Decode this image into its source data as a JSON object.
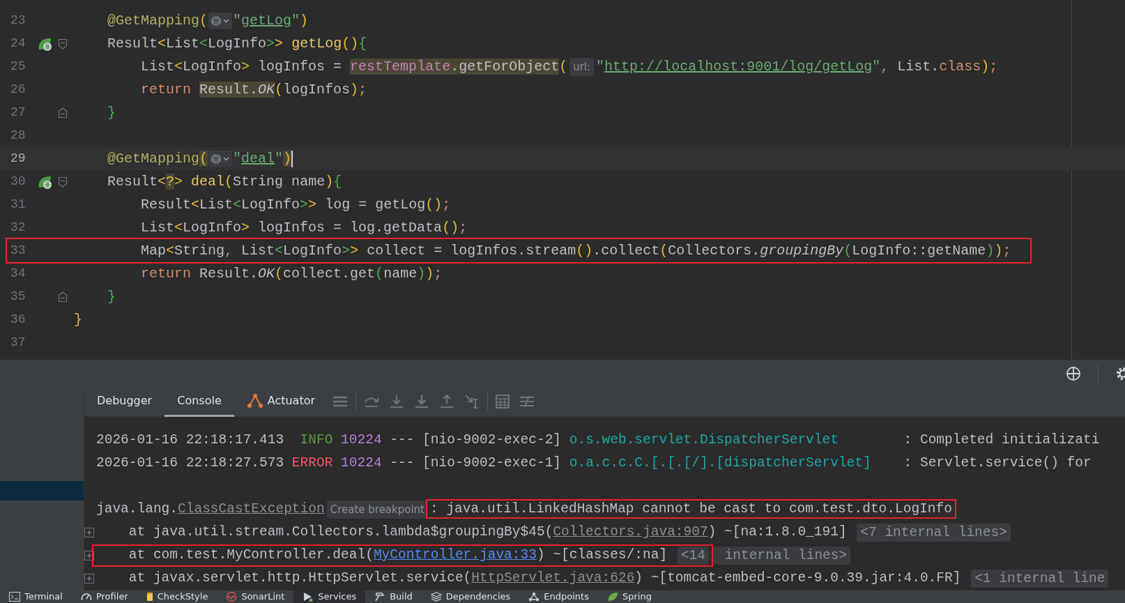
{
  "editor": {
    "lines": [
      {
        "number": "23",
        "tokens": [
          {
            "kind": "ann",
            "text": "    @GetMapping"
          },
          {
            "kind": "b1",
            "text": "("
          },
          {
            "kind": "inlay-globe"
          },
          {
            "kind": "str",
            "text": "\""
          },
          {
            "kind": "strlink",
            "text": "getLog"
          },
          {
            "kind": "str",
            "text": "\""
          },
          {
            "kind": "b1",
            "text": ")"
          }
        ]
      },
      {
        "number": "24",
        "endpoint_icon": true,
        "fold_start": true,
        "tokens": [
          {
            "kind": "plain",
            "text": "    Result"
          },
          {
            "kind": "b1",
            "text": "<"
          },
          {
            "kind": "plain",
            "text": "List"
          },
          {
            "kind": "b2",
            "text": "<"
          },
          {
            "kind": "plain",
            "text": "LogInfo"
          },
          {
            "kind": "b2",
            "text": ">"
          },
          {
            "kind": "b1",
            "text": ">"
          },
          {
            "kind": "decl",
            "text": " getLog"
          },
          {
            "kind": "b1",
            "text": "()"
          },
          {
            "kind": "b2",
            "text": "{"
          }
        ]
      },
      {
        "number": "25",
        "tokens": [
          {
            "kind": "plain",
            "text": "        List"
          },
          {
            "kind": "b1",
            "text": "<"
          },
          {
            "kind": "plain",
            "text": "LogInfo"
          },
          {
            "kind": "b1",
            "text": ">"
          },
          {
            "kind": "plain",
            "text": " logInfos = "
          },
          {
            "kind": "field",
            "text": "restTemplate",
            "marked": true
          },
          {
            "kind": "plain",
            "text": ".getForObject",
            "marked": true
          },
          {
            "kind": "b1",
            "text": "("
          },
          {
            "kind": "hint",
            "text": "url:"
          },
          {
            "kind": "str",
            "text": "\""
          },
          {
            "kind": "strlink",
            "text": "http://localhost:9001/log/getLog"
          },
          {
            "kind": "str",
            "text": "\""
          },
          {
            "kind": "kw",
            "text": ", "
          },
          {
            "kind": "plain",
            "text": "List."
          },
          {
            "kind": "kw",
            "text": "class"
          },
          {
            "kind": "b1",
            "text": ")"
          },
          {
            "kind": "kw",
            "text": ";"
          }
        ]
      },
      {
        "number": "26",
        "tokens": [
          {
            "kind": "kw",
            "text": "        return "
          },
          {
            "kind": "plain",
            "text": "Result.",
            "marked": true
          },
          {
            "kind": "italic",
            "text": "OK",
            "marked": true
          },
          {
            "kind": "b1",
            "text": "("
          },
          {
            "kind": "plain",
            "text": "logInfos"
          },
          {
            "kind": "b1",
            "text": ")"
          },
          {
            "kind": "kw",
            "text": ";"
          }
        ]
      },
      {
        "number": "27",
        "fold_end": true,
        "tokens": [
          {
            "kind": "b2",
            "text": "    }"
          }
        ]
      },
      {
        "number": "28"
      },
      {
        "number": "29",
        "current": true,
        "tokens": [
          {
            "kind": "ann",
            "text": "    @GetMapping"
          },
          {
            "kind": "b1",
            "text": "(",
            "marked": true
          },
          {
            "kind": "inlay-globe"
          },
          {
            "kind": "str",
            "text": "\""
          },
          {
            "kind": "strlink",
            "text": "deal"
          },
          {
            "kind": "str",
            "text": "\""
          },
          {
            "kind": "b1",
            "text": ")",
            "marked": true
          }
        ]
      },
      {
        "number": "30",
        "endpoint_icon": true,
        "fold_start": true,
        "tokens": [
          {
            "kind": "plain",
            "text": "    Result"
          },
          {
            "kind": "b1",
            "text": "<"
          },
          {
            "kind": "b1",
            "text": "?",
            "marked": true
          },
          {
            "kind": "b1",
            "text": ">"
          },
          {
            "kind": "decl",
            "text": " deal"
          },
          {
            "kind": "b1",
            "text": "("
          },
          {
            "kind": "plain",
            "text": "String name"
          },
          {
            "kind": "b1",
            "text": ")"
          },
          {
            "kind": "b2",
            "text": "{"
          }
        ]
      },
      {
        "number": "31",
        "tokens": [
          {
            "kind": "plain",
            "text": "        Result"
          },
          {
            "kind": "b1",
            "text": "<"
          },
          {
            "kind": "plain",
            "text": "List"
          },
          {
            "kind": "b2",
            "text": "<"
          },
          {
            "kind": "plain",
            "text": "LogInfo"
          },
          {
            "kind": "b2",
            "text": ">"
          },
          {
            "kind": "b1",
            "text": ">"
          },
          {
            "kind": "plain",
            "text": " log = getLog"
          },
          {
            "kind": "b1",
            "text": "()"
          },
          {
            "kind": "kw",
            "text": ";"
          }
        ]
      },
      {
        "number": "32",
        "tokens": [
          {
            "kind": "plain",
            "text": "        List"
          },
          {
            "kind": "b1",
            "text": "<"
          },
          {
            "kind": "plain",
            "text": "LogInfo"
          },
          {
            "kind": "b1",
            "text": ">"
          },
          {
            "kind": "plain",
            "text": " logInfos = log.getData"
          },
          {
            "kind": "b1",
            "text": "()"
          },
          {
            "kind": "kw",
            "text": ";"
          }
        ]
      },
      {
        "number": "33",
        "highlighted": true,
        "tokens": [
          {
            "kind": "plain",
            "text": "        Map"
          },
          {
            "kind": "b1",
            "text": "<"
          },
          {
            "kind": "plain",
            "text": "String"
          },
          {
            "kind": "kw",
            "text": ", "
          },
          {
            "kind": "plain",
            "text": "List"
          },
          {
            "kind": "b2",
            "text": "<"
          },
          {
            "kind": "plain",
            "text": "LogInfo"
          },
          {
            "kind": "b2",
            "text": ">"
          },
          {
            "kind": "b1",
            "text": ">"
          },
          {
            "kind": "plain",
            "text": " collect = logInfos.stream"
          },
          {
            "kind": "b1",
            "text": "()"
          },
          {
            "kind": "plain",
            "text": ".collect"
          },
          {
            "kind": "b1",
            "text": "("
          },
          {
            "kind": "plain",
            "text": "Collectors."
          },
          {
            "kind": "italic",
            "text": "groupingBy"
          },
          {
            "kind": "b2",
            "text": "("
          },
          {
            "kind": "plain",
            "text": "LogInfo::getName"
          },
          {
            "kind": "b2",
            "text": ")"
          },
          {
            "kind": "b1",
            "text": ")"
          },
          {
            "kind": "kw",
            "text": ";"
          }
        ]
      },
      {
        "number": "34",
        "tokens": [
          {
            "kind": "kw",
            "text": "        return "
          },
          {
            "kind": "plain",
            "text": "Result."
          },
          {
            "kind": "italic",
            "text": "OK"
          },
          {
            "kind": "b1",
            "text": "("
          },
          {
            "kind": "plain",
            "text": "collect.get"
          },
          {
            "kind": "b2",
            "text": "("
          },
          {
            "kind": "plain",
            "text": "name"
          },
          {
            "kind": "b2",
            "text": ")"
          },
          {
            "kind": "b1",
            "text": ")"
          },
          {
            "kind": "kw",
            "text": ";"
          }
        ]
      },
      {
        "number": "35",
        "fold_end": true,
        "tokens": [
          {
            "kind": "b2",
            "text": "    }"
          }
        ]
      },
      {
        "number": "36",
        "tokens": [
          {
            "kind": "b1",
            "text": "}"
          }
        ]
      },
      {
        "number": "37"
      }
    ]
  },
  "tool_window": {
    "tabs": [
      {
        "label": "Debugger",
        "selected": false
      },
      {
        "label": "Console",
        "selected": true
      },
      {
        "label": "Actuator",
        "selected": false
      }
    ]
  },
  "console": {
    "lines": [
      {
        "kind": "log",
        "tokens": [
          {
            "kind": "plain",
            "text": "2026-01-16 22:18:17.413"
          },
          {
            "kind": "info",
            "text": "  INFO "
          },
          {
            "kind": "pid",
            "text": "10224"
          },
          {
            "kind": "plain",
            "text": " --- [nio-9002-exec-2] "
          },
          {
            "kind": "logger",
            "text": "o.s.web.servlet.DispatcherServlet"
          },
          {
            "kind": "plain",
            "text": "        : Completed initializati"
          }
        ]
      },
      {
        "kind": "log",
        "tokens": [
          {
            "kind": "plain",
            "text": "2026-01-16 22:18:27.573 "
          },
          {
            "kind": "error",
            "text": "ERROR"
          },
          {
            "kind": "pid",
            "text": " 10224"
          },
          {
            "kind": "plain",
            "text": " --- [nio-9002-exec-1] "
          },
          {
            "kind": "logger",
            "text": "o.a.c.c.C.[.[.[/].[dispatcherServlet]"
          },
          {
            "kind": "plain",
            "text": "    : Servlet.service() for"
          }
        ]
      },
      {
        "kind": "blank"
      },
      {
        "kind": "exception",
        "tokens": [
          {
            "kind": "plain",
            "text": "java.lang."
          },
          {
            "kind": "link-gray",
            "text": "ClassCastException"
          },
          {
            "kind": "hint-action",
            "text": "Create breakpoint"
          },
          {
            "kind": "plain",
            "text": ": java.util.LinkedHashMap cannot be cast to com.test.dto.LogInfo",
            "boxed": true
          }
        ]
      },
      {
        "kind": "trace",
        "tokens": [
          {
            "kind": "plain",
            "text": "    at java.util.stream.Collectors.lambda$groupingBy$45("
          },
          {
            "kind": "link-gray",
            "text": "Collectors.java:907"
          },
          {
            "kind": "plain",
            "text": ") ~[na:1.8.0_191] "
          },
          {
            "kind": "hint-fold",
            "text": "<7 internal lines>"
          }
        ]
      },
      {
        "kind": "trace",
        "tokens": [
          {
            "kind": "plain",
            "text": "    at com.test.MyController.deal(",
            "boxed": true
          },
          {
            "kind": "link-blue",
            "text": "MyController.java:33",
            "boxed": true
          },
          {
            "kind": "plain",
            "text": ") ~[classes/:na] ",
            "boxed": true
          },
          {
            "kind": "hint-fold",
            "text": "<14",
            "boxed": true
          },
          {
            "kind": "hint-fold",
            "text": " internal lines>"
          }
        ]
      },
      {
        "kind": "trace",
        "tokens": [
          {
            "kind": "plain",
            "text": "    at javax.servlet.http.HttpServlet.service("
          },
          {
            "kind": "link-gray",
            "text": "HttpServlet.java:626"
          },
          {
            "kind": "plain",
            "text": ") ~[tomcat-embed-core-9.0.39.jar:4.0.FR] "
          },
          {
            "kind": "hint-fold",
            "text": "<1 internal line"
          }
        ]
      }
    ]
  },
  "bottom_bar": [
    {
      "label": "Terminal",
      "selected": false
    },
    {
      "label": "Profiler",
      "selected": false
    },
    {
      "label": "CheckStyle",
      "selected": false
    },
    {
      "label": "SonarLint",
      "selected": false
    },
    {
      "label": "Services",
      "selected": true
    },
    {
      "label": "Build",
      "selected": false
    },
    {
      "label": "Dependencies",
      "selected": false
    },
    {
      "label": "Endpoints",
      "selected": false
    },
    {
      "label": "Spring",
      "selected": false
    }
  ]
}
